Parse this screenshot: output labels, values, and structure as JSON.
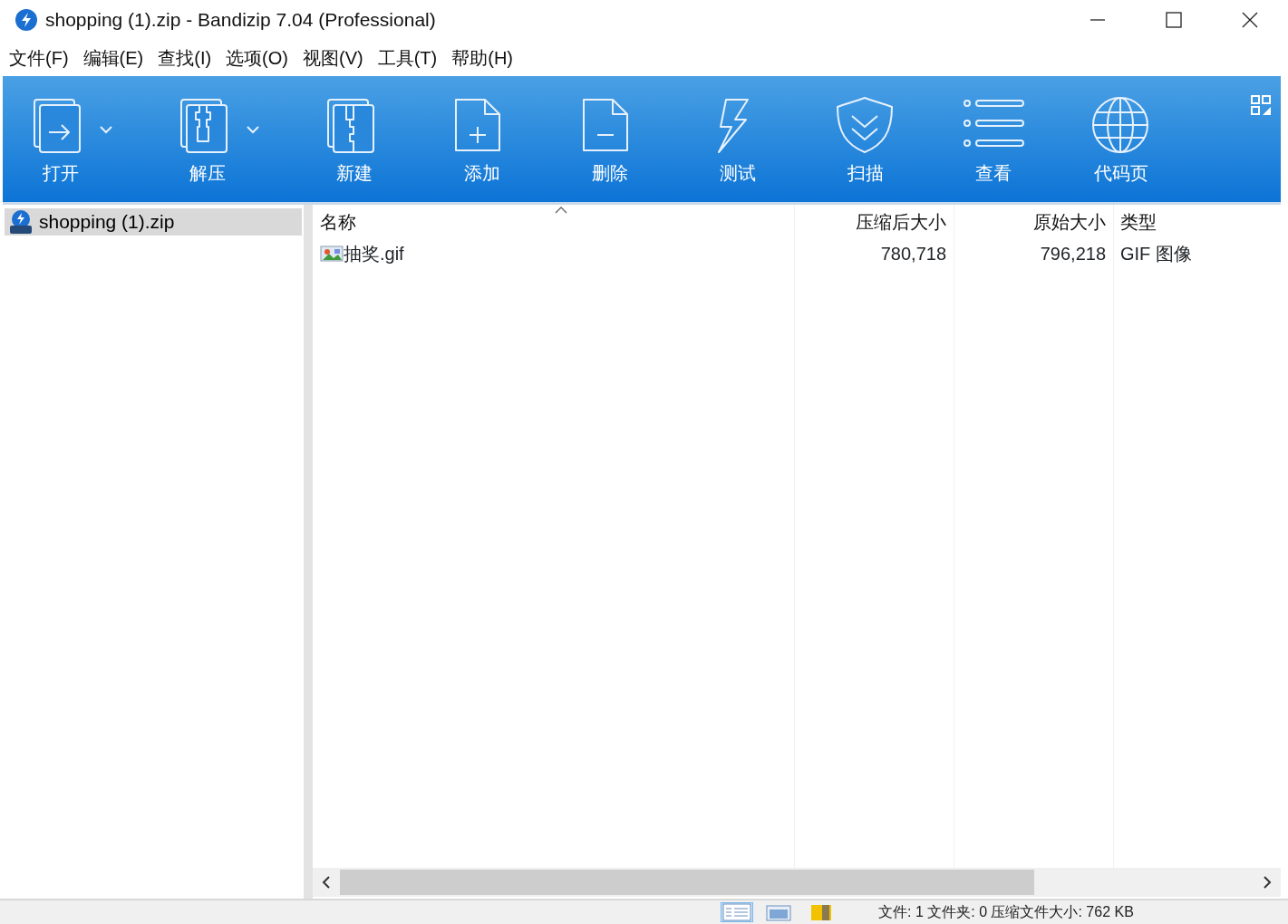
{
  "window": {
    "title": "shopping (1).zip - Bandizip 7.04 (Professional)"
  },
  "menu": [
    "文件(F)",
    "编辑(E)",
    "查找(I)",
    "选项(O)",
    "视图(V)",
    "工具(T)",
    "帮助(H)"
  ],
  "toolbar": [
    {
      "label": "打开",
      "kind": "open",
      "dropdown": true
    },
    {
      "label": "解压",
      "kind": "extract",
      "dropdown": true
    },
    {
      "label": "新建",
      "kind": "new",
      "dropdown": false
    },
    {
      "label": "添加",
      "kind": "add",
      "dropdown": false
    },
    {
      "label": "删除",
      "kind": "delete",
      "dropdown": false
    },
    {
      "label": "测试",
      "kind": "test",
      "dropdown": false
    },
    {
      "label": "扫描",
      "kind": "scan",
      "dropdown": false
    },
    {
      "label": "查看",
      "kind": "view",
      "dropdown": false
    },
    {
      "label": "代码页",
      "kind": "codepage",
      "dropdown": false
    }
  ],
  "tree": [
    {
      "label": "shopping (1).zip",
      "selected": true
    }
  ],
  "table": {
    "columns": [
      "名称",
      "压缩后大小",
      "原始大小",
      "类型"
    ],
    "rows": [
      {
        "name": "抽奖.gif",
        "packed": "780,718",
        "size": "796,218",
        "type": "GIF 图像",
        "selected": false
      }
    ]
  },
  "view_buttons": [
    {
      "kind": "details",
      "selected": true
    },
    {
      "kind": "thumbnails",
      "selected": false
    }
  ],
  "status_bar": "文件: 1 文件夹: 0 压缩文件大小: 762 KB"
}
